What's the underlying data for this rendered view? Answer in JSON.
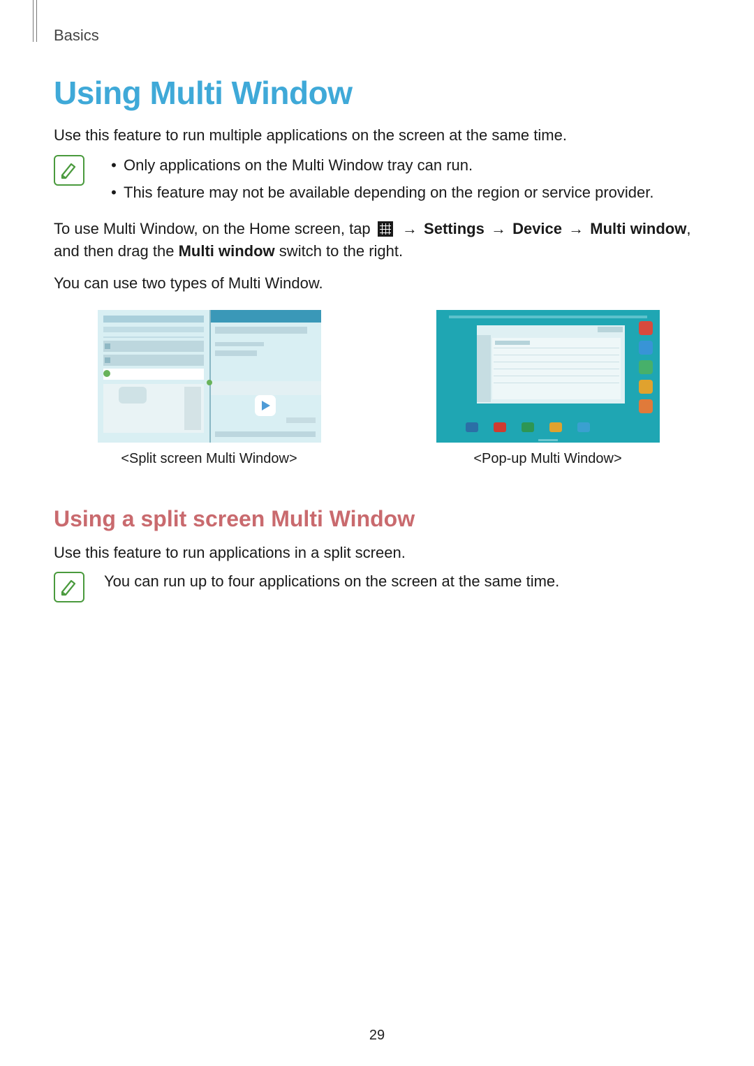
{
  "header": {
    "section": "Basics"
  },
  "title": "Using Multi Window",
  "intro": "Use this feature to run multiple applications on the screen at the same time.",
  "note1": {
    "items": [
      "Only applications on the Multi Window tray can run.",
      "This feature may not be available depending on the region or service provider."
    ]
  },
  "instruction": {
    "pre": "To use Multi Window, on the Home screen, tap ",
    "arrow": "→",
    "path": [
      "Settings",
      "Device",
      "Multi window"
    ],
    "mid": ", and then drag the ",
    "bold_switch": "Multi window",
    "post": " switch to the right."
  },
  "types_text": "You can use two types of Multi Window.",
  "figures": {
    "left_caption": "<Split screen Multi Window>",
    "right_caption": "<Pop-up Multi Window>"
  },
  "subtitle": "Using a split screen Multi Window",
  "sub_intro": "Use this feature to run applications in a split screen.",
  "note2": {
    "text": "You can run up to four applications on the screen at the same time."
  },
  "page_number": "29"
}
